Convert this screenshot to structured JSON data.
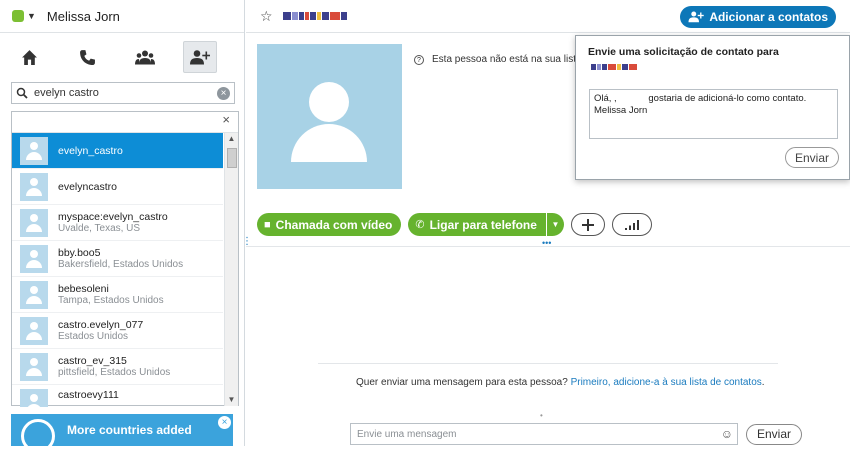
{
  "user": {
    "name": "Melissa Jorn"
  },
  "search": {
    "value": "evelyn castro"
  },
  "results": [
    {
      "name": "evelyn_castro",
      "sub": ""
    },
    {
      "name": "evelyncastro",
      "sub": ""
    },
    {
      "name": "myspace:evelyn_castro",
      "sub": "Uvalde, Texas, US"
    },
    {
      "name": "bby.boo5",
      "sub": "Bakersfield, Estados Unidos"
    },
    {
      "name": "bebesoleni",
      "sub": "Tampa, Estados Unidos"
    },
    {
      "name": "castro.evelyn_077",
      "sub": "Estados Unidos"
    },
    {
      "name": "castro_ev_315",
      "sub": "pittsfield, Estados Unidos"
    },
    {
      "name": "castroevy111",
      "sub": ""
    }
  ],
  "promo": {
    "text": "More countries added"
  },
  "header": {
    "add_contact_label": "Adicionar a contatos"
  },
  "profile": {
    "notice": "Esta pessoa não está na sua lista"
  },
  "actions": {
    "video_call": "Chamada com vídeo",
    "call_phone": "Ligar para telefone"
  },
  "chat": {
    "notice_prefix": "Quer enviar uma mensagem para esta pessoa? ",
    "notice_link": "Primeiro, adicione-a à sua lista de contatos",
    "notice_suffix": ".",
    "input_placeholder": "Envie uma mensagem",
    "send_label": "Enviar"
  },
  "popup": {
    "title": "Envie uma solicitação de contato para",
    "message": "Olá, ,            gostaria de adicioná-lo como contato.\nMelissa Jorn",
    "send_label": "Enviar"
  },
  "colors": {
    "accent_blue": "#0d77b8",
    "green": "#66b32e",
    "selected": "#0d8dd6"
  }
}
